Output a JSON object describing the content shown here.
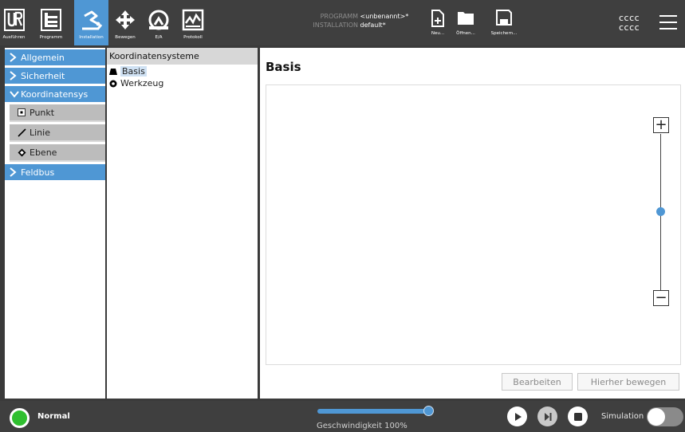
{
  "topnav": {
    "items": [
      {
        "label": "Ausführen",
        "icon": "ur-logo-icon"
      },
      {
        "label": "Programm",
        "icon": "program-tree-icon"
      },
      {
        "label": "Installation",
        "icon": "installation-icon",
        "active": true
      },
      {
        "label": "Bewegen",
        "icon": "move-arrows-icon"
      },
      {
        "label": "E/A",
        "icon": "io-gauge-icon"
      },
      {
        "label": "Protokoll",
        "icon": "log-chart-icon"
      }
    ]
  },
  "program_info": {
    "program_key": "PROGRAMM",
    "program_value": "<unbenannt>*",
    "installation_key": "INSTALLATION",
    "installation_value": "default*"
  },
  "file_actions": {
    "new_label": "Neu...",
    "open_label": "Öffnen...",
    "save_label": "Speichern..."
  },
  "user": {
    "line1": "cccc",
    "line2": "cccc"
  },
  "sidebar": {
    "items": [
      {
        "label": "Allgemein"
      },
      {
        "label": "Sicherheit"
      },
      {
        "label": "Koordinatensys"
      },
      {
        "label": "Punkt"
      },
      {
        "label": "Linie"
      },
      {
        "label": "Ebene"
      },
      {
        "label": "Feldbus"
      }
    ]
  },
  "tree": {
    "header": "Koordinatensysteme",
    "nodes": [
      {
        "label": "Basis",
        "selected": true
      },
      {
        "label": "Werkzeug"
      }
    ]
  },
  "main": {
    "title": "Basis",
    "zoom_in": "+",
    "zoom_out": "−",
    "zoom_level": 0.5,
    "edit_label": "Bearbeiten",
    "move_here_label": "Hierher bewegen"
  },
  "status": {
    "mode": "Normal",
    "mode_color": "#2fbf2f",
    "speed_label": "Geschwindigkeit 100%",
    "speed_value": 1.0,
    "simulation_label": "Simulation",
    "simulation_on": false
  },
  "colors": {
    "accent": "#4f97d4",
    "topbar": "#3f3f3f"
  }
}
